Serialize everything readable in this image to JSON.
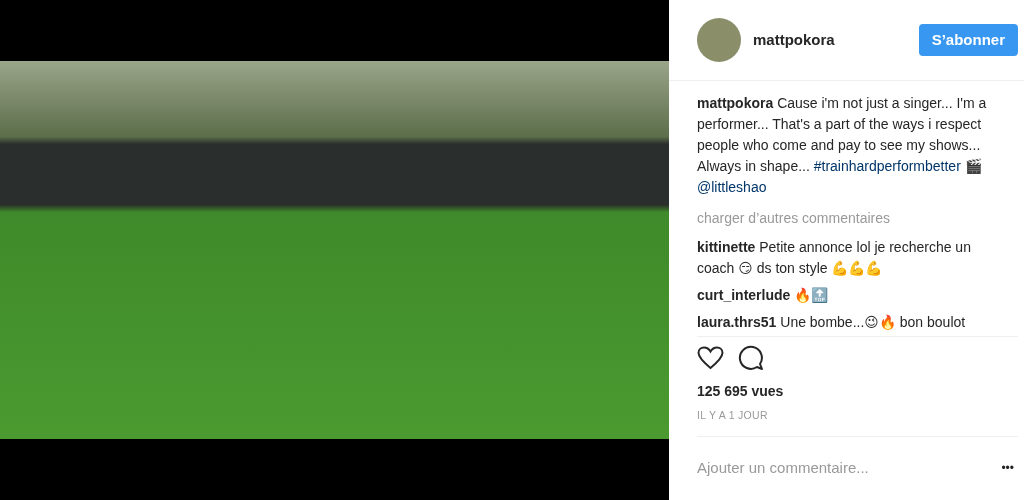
{
  "post": {
    "media": {
      "kind": "video"
    },
    "author": {
      "username": "mattpokora"
    },
    "follow_button": "S’abonner",
    "caption": {
      "username": "mattpokora",
      "text": "Cause i'm not just a singer... I'm a performer... That's a part of the ways i respect people who come and pay to see my shows... Always in shape...",
      "hashtag": "#trainhardperformbetter",
      "emoji": "🎬",
      "mention": "@littleshao"
    },
    "load_more": "charger d’autres commentaires",
    "comments": [
      {
        "username": "kittinette",
        "text": "Petite annonce lol je recherche un coach 😏 ds ton style 💪💪💪"
      },
      {
        "username": "curt_interlude",
        "text": "🔥🔝"
      },
      {
        "username": "laura.thrs51",
        "text": "Une bombe...😉🔥 bon boulot"
      }
    ],
    "actions": [
      {
        "kind": "like"
      },
      {
        "kind": "comment"
      }
    ],
    "views": "125 695 vues",
    "time": "IL Y A 1 JOUR",
    "comment_field": {
      "placeholder": "Ajouter un commentaire..."
    },
    "more_button": "•••"
  }
}
